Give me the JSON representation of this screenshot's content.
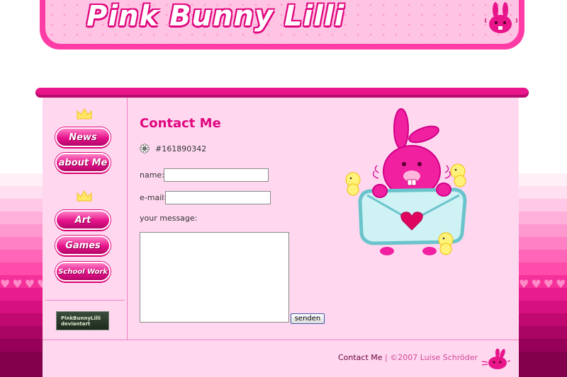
{
  "header": {
    "logo_text": "Pink Bunny Lilli"
  },
  "nav": {
    "news": "News",
    "about": "about Me",
    "art": "Art",
    "games": "Games",
    "school": "School Work",
    "badge": "PinkBunnyLilli deviantart"
  },
  "content": {
    "title": "Contact Me",
    "icq_number": "#161890342",
    "name_label": "name:",
    "email_label": "e-mail:",
    "message_label": "your message:",
    "send_label": "senden",
    "name_value": "",
    "email_value": ""
  },
  "footer": {
    "link": "Contact Me",
    "separator": "|",
    "copyright": "©2007 Luise Schröder"
  },
  "colors": {
    "accent": "#e0067e",
    "panel": "#ffd8f0",
    "bar": "#e8168a"
  }
}
